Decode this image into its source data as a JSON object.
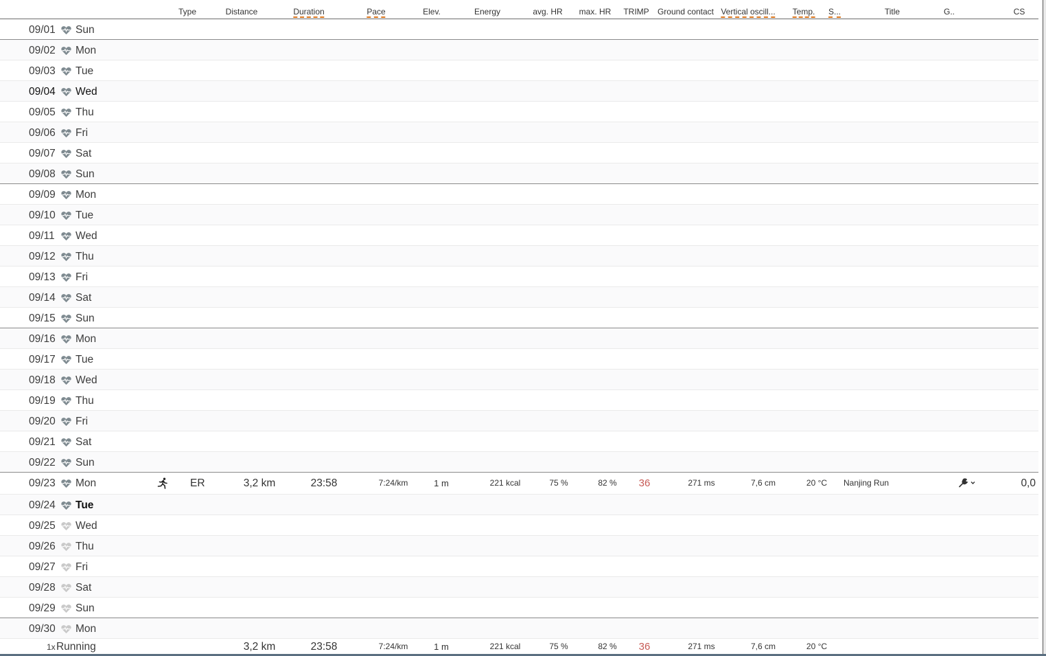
{
  "columns": {
    "type": "Type",
    "distance": "Distance",
    "duration": "Duration",
    "pace": "Pace",
    "elev": "Elev.",
    "energy": "Energy",
    "avg_hr": "avg. HR",
    "max_hr": "max. HR",
    "trimp": "TRIMP",
    "ground_contact": "Ground contact",
    "vertical_osc": "Vertical oscill...",
    "temp": "Temp.",
    "s": "S...",
    "title": "Title",
    "g": "G..",
    "cs": "CS"
  },
  "days": [
    {
      "date": "09/01",
      "day": "Sun"
    },
    {
      "date": "09/02",
      "day": "Mon"
    },
    {
      "date": "09/03",
      "day": "Tue"
    },
    {
      "date": "09/04",
      "day": "Wed"
    },
    {
      "date": "09/05",
      "day": "Thu"
    },
    {
      "date": "09/06",
      "day": "Fri"
    },
    {
      "date": "09/07",
      "day": "Sat"
    },
    {
      "date": "09/08",
      "day": "Sun"
    },
    {
      "date": "09/09",
      "day": "Mon"
    },
    {
      "date": "09/10",
      "day": "Tue"
    },
    {
      "date": "09/11",
      "day": "Wed"
    },
    {
      "date": "09/12",
      "day": "Thu"
    },
    {
      "date": "09/13",
      "day": "Fri"
    },
    {
      "date": "09/14",
      "day": "Sat"
    },
    {
      "date": "09/15",
      "day": "Sun"
    },
    {
      "date": "09/16",
      "day": "Mon"
    },
    {
      "date": "09/17",
      "day": "Tue"
    },
    {
      "date": "09/18",
      "day": "Wed"
    },
    {
      "date": "09/19",
      "day": "Thu"
    },
    {
      "date": "09/20",
      "day": "Fri"
    },
    {
      "date": "09/21",
      "day": "Sat"
    },
    {
      "date": "09/22",
      "day": "Sun"
    },
    {
      "date": "09/23",
      "day": "Mon"
    },
    {
      "date": "09/24",
      "day": "Tue"
    },
    {
      "date": "09/25",
      "day": "Wed"
    },
    {
      "date": "09/26",
      "day": "Thu"
    },
    {
      "date": "09/27",
      "day": "Fri"
    },
    {
      "date": "09/28",
      "day": "Sat"
    },
    {
      "date": "09/29",
      "day": "Sun"
    },
    {
      "date": "09/30",
      "day": "Mon"
    }
  ],
  "activity": {
    "type": "ER",
    "distance": "3,2 km",
    "duration": "23:58",
    "pace": "7:24/km",
    "elev": "1 m",
    "energy": "221 kcal",
    "avg_hr": "75 %",
    "max_hr": "82 %",
    "trimp": "36",
    "ground_contact": "271 ms",
    "vertical_osc": "7,6 cm",
    "temp": "20 °C",
    "title": "Nanjing Run",
    "cs": "0,0"
  },
  "summary": {
    "count": "1x",
    "sport": "Running",
    "distance": "3,2 km",
    "duration": "23:58",
    "pace": "7:24/km",
    "elev": "1 m",
    "energy": "221 kcal",
    "avg_hr": "75 %",
    "max_hr": "82 %",
    "trimp": "36",
    "ground_contact": "271 ms",
    "vertical_osc": "7,6 cm",
    "temp": "20 °C"
  },
  "colors": {
    "heart_active": "#7e8a90",
    "heart_inactive": "#c9c9c9",
    "trimp": "#c75a55",
    "dashed_underline": "#d9731a",
    "moon": "#e8a21a"
  }
}
